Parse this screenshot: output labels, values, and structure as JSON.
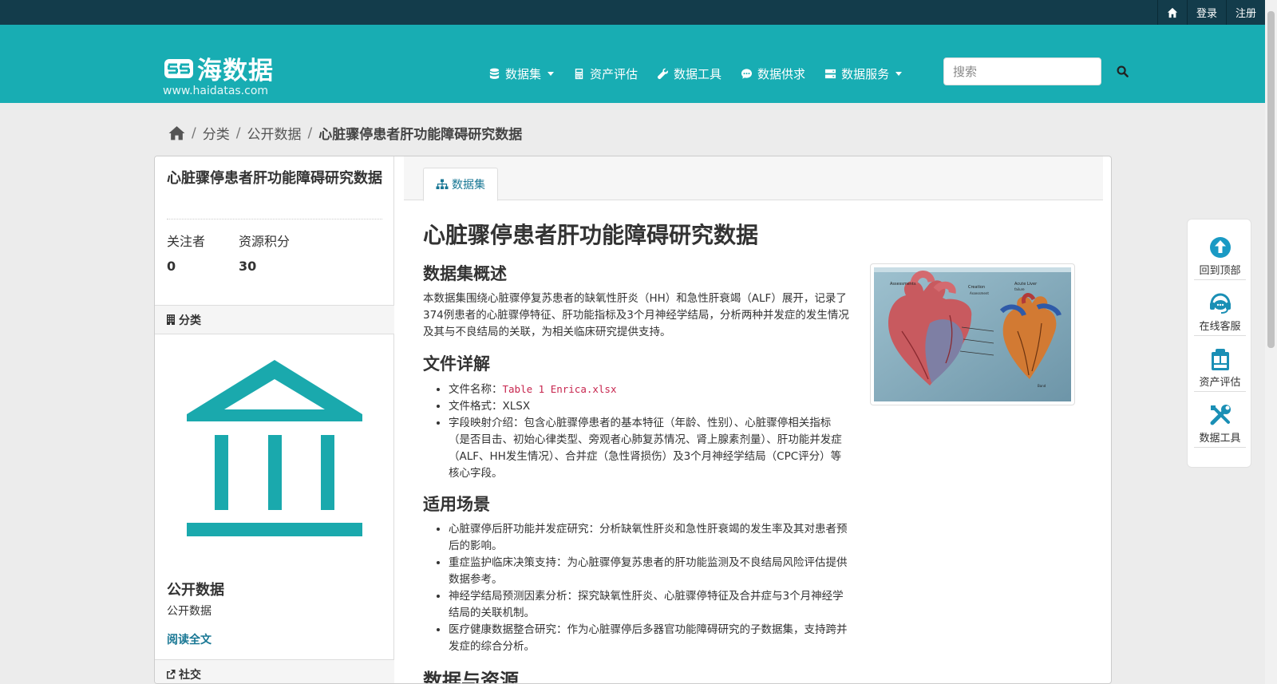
{
  "topbar": {
    "home_label": "home",
    "login": "登录",
    "register": "注册"
  },
  "logo": {
    "name": "海数据",
    "url": "www.haidatas.com"
  },
  "nav": {
    "datasets": "数据集",
    "assessment": "资产评估",
    "tools": "数据工具",
    "supply": "数据供求",
    "services": "数据服务"
  },
  "search": {
    "placeholder": "搜索"
  },
  "breadcrumb": {
    "category": "分类",
    "public": "公开数据",
    "current": "心脏骤停患者肝功能障碍研究数据"
  },
  "sidebar": {
    "title": "心脏骤停患者肝功能障碍研究数据",
    "followers_label": "关注者",
    "followers_value": "0",
    "points_label": "资源积分",
    "points_value": "30",
    "category_header": "分类",
    "org_name": "公开数据",
    "org_desc": "公开数据",
    "read_more": "阅读全文",
    "social_header": "社交"
  },
  "tab": {
    "label": "数据集"
  },
  "content": {
    "title": "心脏骤停患者肝功能障碍研究数据",
    "overview_heading": "数据集概述",
    "overview_text": "本数据集围绕心脏骤停复苏患者的缺氧性肝炎（HH）和急性肝衰竭（ALF）展开，记录了374例患者的心脏骤停特征、肝功能指标及3个月神经学结局，分析两种并发症的发生情况及其与不良结局的关联，为相关临床研究提供支持。",
    "file_heading": "文件详解",
    "file_name_label": "文件名称：",
    "file_name": "Table 1 Enrica.xlsx",
    "file_format": "文件格式：XLSX",
    "fields": "字段映射介绍：包含心脏骤停患者的基本特征（年龄、性别）、心脏骤停相关指标（是否目击、初始心律类型、旁观者心肺复苏情况、肾上腺素剂量）、肝功能并发症（ALF、HH发生情况）、合并症（急性肾损伤）及3个月神经学结局（CPC评分）等核心字段。",
    "usage_heading": "适用场景",
    "usage": [
      "心脏骤停后肝功能并发症研究：分析缺氧性肝炎和急性肝衰竭的发生率及其对患者预后的影响。",
      "重症监护临床决策支持：为心脏骤停复苏患者的肝功能监测及不良结局风险评估提供数据参考。",
      "神经学结局预测因素分析：探究缺氧性肝炎、心脏骤停特征及合并症与3个月神经学结局的关联机制。",
      "医疗健康数据整合研究：作为心脏骤停后多器官功能障碍研究的子数据集，支持跨并发症的综合分析。"
    ],
    "resources_heading": "数据与资源"
  },
  "float_panel": {
    "top": "回到顶部",
    "service": "在线客服",
    "assess": "资产评估",
    "tools": "数据工具"
  },
  "colors": {
    "header": "#18adb3",
    "topbar": "#133c4b",
    "link": "#187794",
    "icon_teal": "#1aa9ad"
  }
}
